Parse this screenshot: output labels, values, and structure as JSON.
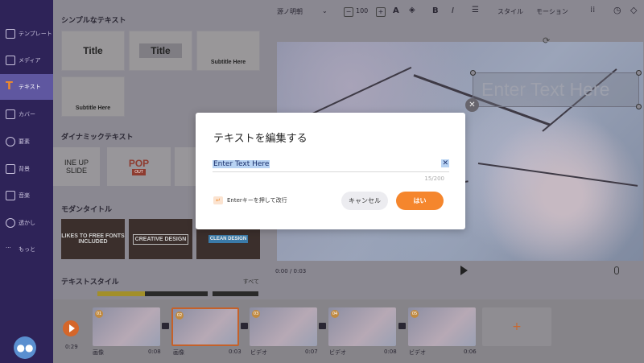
{
  "sidebar": {
    "items": [
      {
        "label": "テンプレート",
        "icon": "layers-icon"
      },
      {
        "label": "メディア",
        "icon": "folder-icon"
      },
      {
        "label": "テキスト",
        "icon": "text-icon",
        "active": true
      },
      {
        "label": "カバー",
        "icon": "cover-icon"
      },
      {
        "label": "要素",
        "icon": "shapes-icon"
      },
      {
        "label": "背景",
        "icon": "image-icon"
      },
      {
        "label": "音楽",
        "icon": "music-icon"
      },
      {
        "label": "透かし",
        "icon": "watermark-icon"
      },
      {
        "label": "もっと",
        "icon": "more-icon"
      }
    ]
  },
  "text_panel": {
    "simple_title": "シンプルなテキスト",
    "simple_tiles": [
      "Title",
      "Title",
      "Subtitle Here",
      "Subtitle Here"
    ],
    "dynamic_title": "ダイナミックテキスト",
    "dynamic_tiles": [
      {
        "line1": "INE UP",
        "line2": "SLIDE"
      },
      {
        "line1": "POP",
        "line2": "OUT"
      }
    ],
    "modern_title": "モダンタイトル",
    "modern_tiles": [
      "LIKES TO FREE FONTS INCLUDED",
      "CREATIVE DESIGN",
      "CLEAN DESIGN"
    ],
    "style_title": "テキストスタイル",
    "see_all": "すべて"
  },
  "toolbar": {
    "font": "源ノ明朝",
    "size": "100",
    "style_label": "スタイル",
    "motion_label": "モーション"
  },
  "canvas": {
    "textbox_text": "Enter Text Here",
    "time": "0:00 / 0:03"
  },
  "timeline": {
    "current_time": "0:29",
    "clips": [
      {
        "num": "01",
        "type": "画像",
        "duration": "0:08"
      },
      {
        "num": "02",
        "type": "画像",
        "duration": "0:03"
      },
      {
        "num": "03",
        "type": "ビデオ",
        "duration": "0:07"
      },
      {
        "num": "04",
        "type": "ビデオ",
        "duration": "0:08"
      },
      {
        "num": "05",
        "type": "ビデオ",
        "duration": "0:06"
      }
    ],
    "add_label": "+"
  },
  "dialog": {
    "title": "テキストを編集する",
    "input_value": "Enter  Text  Here",
    "counter": "15/200",
    "hint": "Enterキーを押して改行",
    "cancel_label": "キャンセル",
    "ok_label": "はい"
  },
  "colors": {
    "accent": "#f5862d",
    "sidebar": "#2e2358",
    "selection": "#b8d3f3"
  }
}
